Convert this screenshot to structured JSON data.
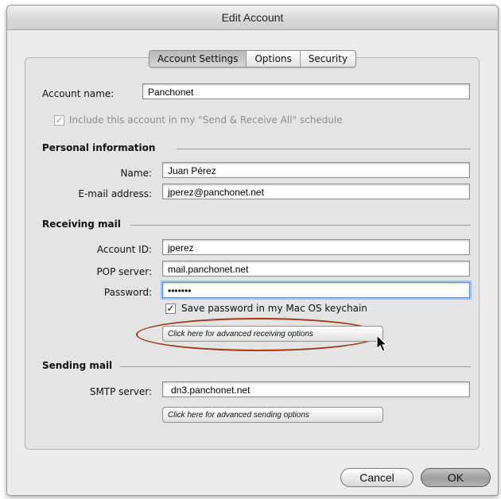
{
  "window": {
    "title": "Edit Account"
  },
  "tabs": [
    {
      "label": "Account Settings",
      "active": true
    },
    {
      "label": "Options",
      "active": false
    },
    {
      "label": "Security",
      "active": false
    }
  ],
  "account": {
    "name_label": "Account name:",
    "name_value": "Panchonet",
    "include_label": "Include this account in my \"Send & Receive All\" schedule",
    "include_checked": true
  },
  "personal": {
    "heading": "Personal information",
    "name_label": "Name:",
    "name_value": "Juan Pérez",
    "email_label": "E-mail address:",
    "email_value": "jperez@panchonet.net"
  },
  "receiving": {
    "heading": "Receiving mail",
    "account_id_label": "Account ID:",
    "account_id_value": "jperez",
    "pop_label": "POP server:",
    "pop_value": "mail.panchonet.net",
    "password_label": "Password:",
    "password_value": "•••••••",
    "save_password_label": "Save password in my Mac OS keychain",
    "save_password_checked": true,
    "advanced_button": "Click here for advanced receiving options"
  },
  "sending": {
    "heading": "Sending mail",
    "smtp_label": "SMTP server:",
    "smtp_value": "dn3.panchonet.net",
    "advanced_button": "Click here for advanced sending options"
  },
  "buttons": {
    "cancel": "Cancel",
    "ok": "OK"
  },
  "check_glyph": "✓",
  "colors": {
    "highlight_ellipse": "#9b3a14",
    "focus_ring": "#9ec0f0"
  }
}
